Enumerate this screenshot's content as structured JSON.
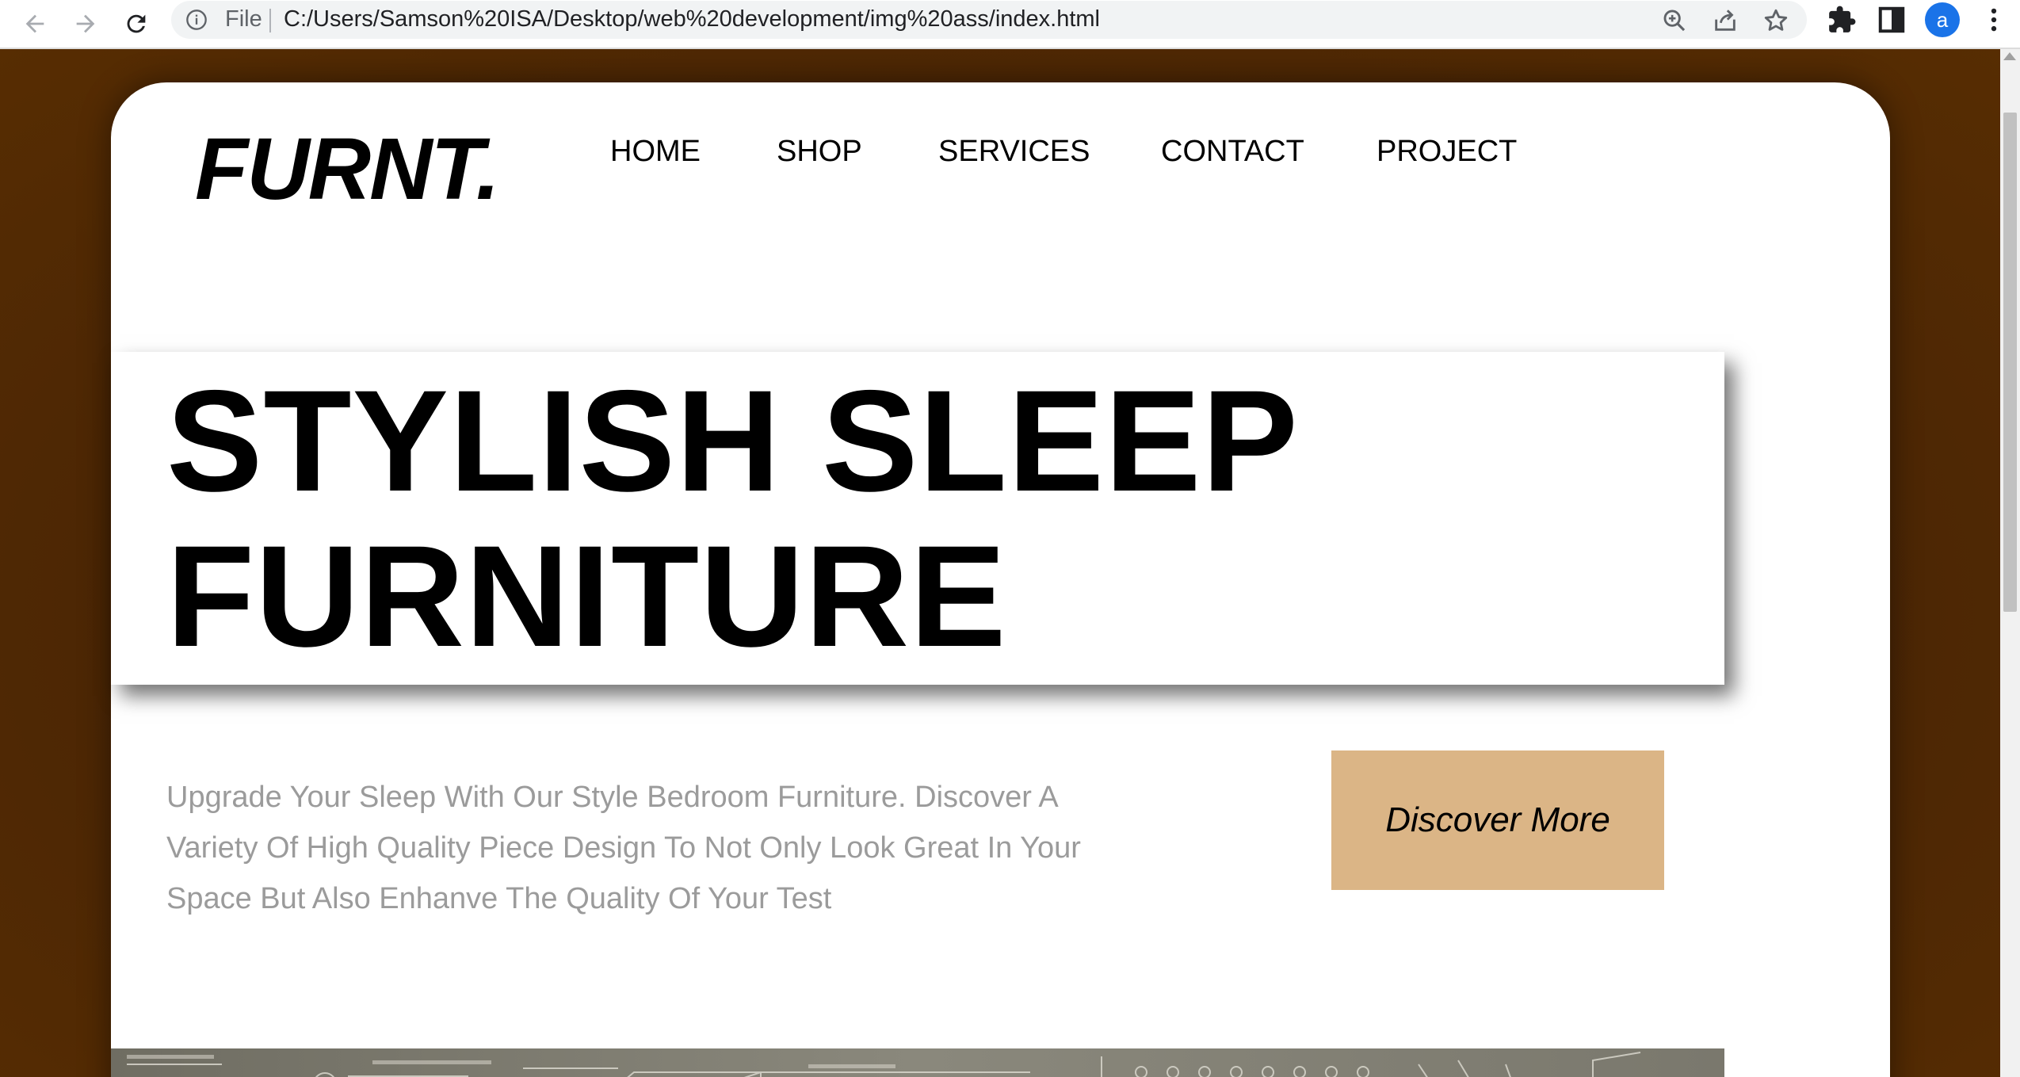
{
  "browser": {
    "url_scheme_label": "File",
    "url": "C:/Users/Samson%20ISA/Desktop/web%20development/img%20ass/index.html",
    "profile_initial": "a",
    "accent_color": "#1a73e8"
  },
  "site": {
    "logo": "FURNT.",
    "nav": [
      {
        "label": "HOME"
      },
      {
        "label": "SHOP"
      },
      {
        "label": "SERVICES"
      },
      {
        "label": "CONTACT"
      },
      {
        "label": "PROJECT"
      }
    ],
    "hero": {
      "line1": "STYLISH SLEEP",
      "line2": "FURNITURE"
    },
    "description": "Upgrade Your Sleep With Our Style Bedroom Furniture. Discover A Variety Of High Quality Piece Design To Not Only Look Great In Your Space But Also Enhanve The Quality Of Your Test",
    "cta_label": "Discover More",
    "colors": {
      "page_background": "#4e2806",
      "cta_background": "#dbb586",
      "description_text": "#9b9b9b"
    }
  },
  "icons": [
    "back-arrow-icon",
    "forward-arrow-icon",
    "reload-icon",
    "info-icon",
    "zoom-icon",
    "share-icon",
    "star-icon",
    "extensions-icon",
    "side-panel-icon",
    "kebab-menu-icon"
  ]
}
